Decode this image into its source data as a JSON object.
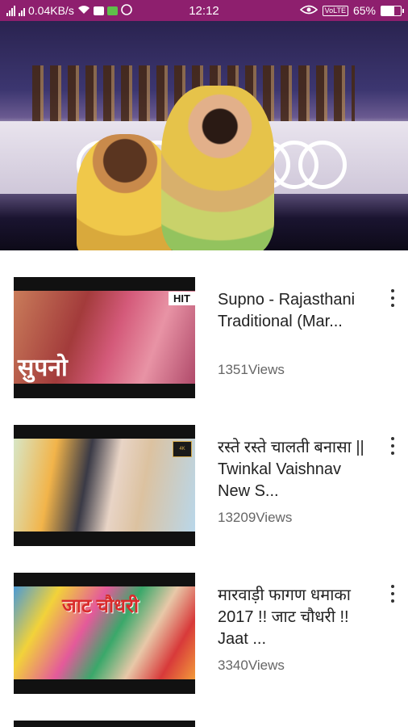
{
  "status_bar": {
    "network_speed": "0.04KB/s",
    "time": "12:12",
    "volte": "VoLTE",
    "battery_percent": "65%",
    "battery_level": 0.65,
    "bg_color": "#8e1f6e"
  },
  "hero": {
    "image_desc_icon": "banner-image"
  },
  "videos": [
    {
      "title": "Supno - Rajasthani Traditional (Mar...",
      "views": "1351Views",
      "thumb_text": "सुपनो",
      "badge": "HIT"
    },
    {
      "title": "रस्ते रस्ते चालती बनासा || Twinkal Vaishnav New S...",
      "views": "13209Views",
      "badge": "4K"
    },
    {
      "title": "मारवाड़ी फागण धमाका 2017 !! जाट चौधरी !! Jaat ...",
      "views": "3340Views",
      "thumb_text": "जाट चौधरी"
    }
  ]
}
